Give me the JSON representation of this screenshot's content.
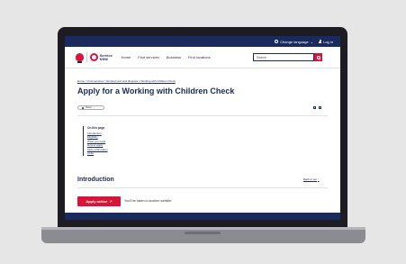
{
  "topbar": {
    "language_label": "Change language",
    "login_label": "Log in"
  },
  "header": {
    "logo_text": "Service NSW",
    "nav": [
      "Home",
      "Find services",
      "Business",
      "Find locations"
    ],
    "search_placeholder": "Search"
  },
  "breadcrumb": "Home  >  Find services  >  Employment and disputes  >  Working with Children Check",
  "page_title": "Apply for a Working with Children Check",
  "share_label": "Share",
  "toc": {
    "title": "On this page",
    "links": [
      "Introduction",
      "Eligibility",
      "What you need",
      "How to apply",
      "More information",
      "Links"
    ]
  },
  "section": {
    "heading": "Introduction",
    "back_to_top": "Back to top"
  },
  "cta": {
    "button_label": "Apply online",
    "note": "You'll be taken to another website."
  },
  "colors": {
    "navy": "#1a2a5c",
    "red": "#d7153a",
    "bezel": "#1c1c22"
  }
}
